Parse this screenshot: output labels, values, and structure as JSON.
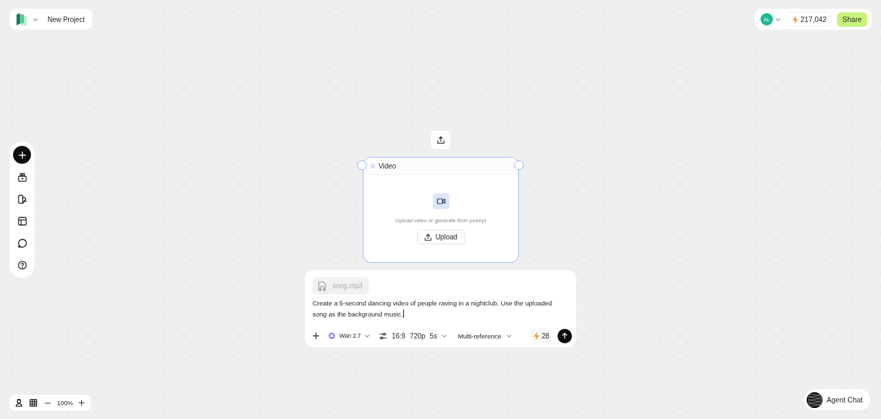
{
  "top_left_bar": {
    "project_name": "New Project"
  },
  "top_right_bar": {
    "avatar_initials": "AL",
    "credits": "217,042",
    "share_label": "Share"
  },
  "video_node": {
    "title": "Video",
    "hint": "Upload video or generate from prompt",
    "upload_label": "Upload"
  },
  "prompt_panel": {
    "attachments": [
      {
        "name": "song.mp3"
      }
    ],
    "prompt": "Create a 5-second dancing video of people raving in a nightclub. Use the uploaded song as the background music.",
    "model": "Wan 2.7",
    "settings": [
      "16:9",
      "720p",
      "5s"
    ],
    "reference_mode": "Multi-reference",
    "cost": "28"
  },
  "canvas_controls": {
    "zoom": "100%"
  },
  "agent_chat": {
    "label": "Agent Chat"
  }
}
